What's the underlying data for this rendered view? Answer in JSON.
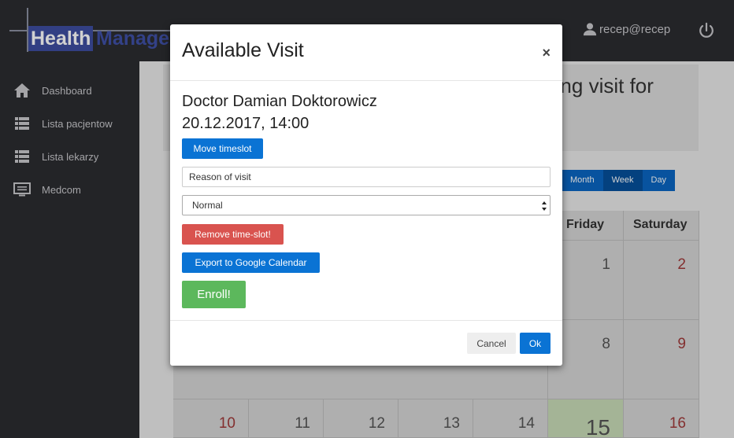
{
  "app": {
    "logo_part1": "Health",
    "logo_part2": "Manage",
    "user_label": "recep@recep"
  },
  "sidebar": {
    "items": [
      {
        "label": "Dashboard",
        "icon": "home-icon"
      },
      {
        "label": "Lista pacjentow",
        "icon": "list-icon"
      },
      {
        "label": "Lista lekarzy",
        "icon": "list-icon"
      },
      {
        "label": "Medcom",
        "icon": "monitor-icon"
      }
    ]
  },
  "main": {
    "heading_fragment": "ring visit for",
    "view_buttons": [
      "Month",
      "Week",
      "Day"
    ],
    "active_view": "Week"
  },
  "calendar": {
    "headers": [
      "Friday",
      "Saturday"
    ],
    "days": [
      {
        "num": "1",
        "weekend": false
      },
      {
        "num": "2",
        "weekend": true
      },
      {
        "num": "8",
        "weekend": false
      },
      {
        "num": "9",
        "weekend": true
      },
      {
        "num": "10",
        "weekend": true
      },
      {
        "num": "11",
        "weekend": false
      },
      {
        "num": "12",
        "weekend": false
      },
      {
        "num": "13",
        "weekend": false
      },
      {
        "num": "14",
        "weekend": false
      },
      {
        "num": "15",
        "weekend": false,
        "today": true
      },
      {
        "num": "16",
        "weekend": true
      }
    ]
  },
  "modal": {
    "title": "Available Visit",
    "close_symbol": "×",
    "doctor": "Doctor Damian Doktorowicz",
    "datetime": "20.12.2017, 14:00",
    "move_timeslot": "Move timeslot",
    "reason_placeholder": "Reason of visit",
    "priority_value": "Normal",
    "remove_timeslot": "Remove time-slot!",
    "export_gcal": "Export to Google Calendar",
    "enroll": "Enroll!",
    "cancel": "Cancel",
    "ok": "Ok"
  },
  "colors": {
    "primary": "#0a73d4",
    "danger": "#d9534f",
    "success": "#5cb85c",
    "sidebar_bg": "#2b2c30"
  }
}
